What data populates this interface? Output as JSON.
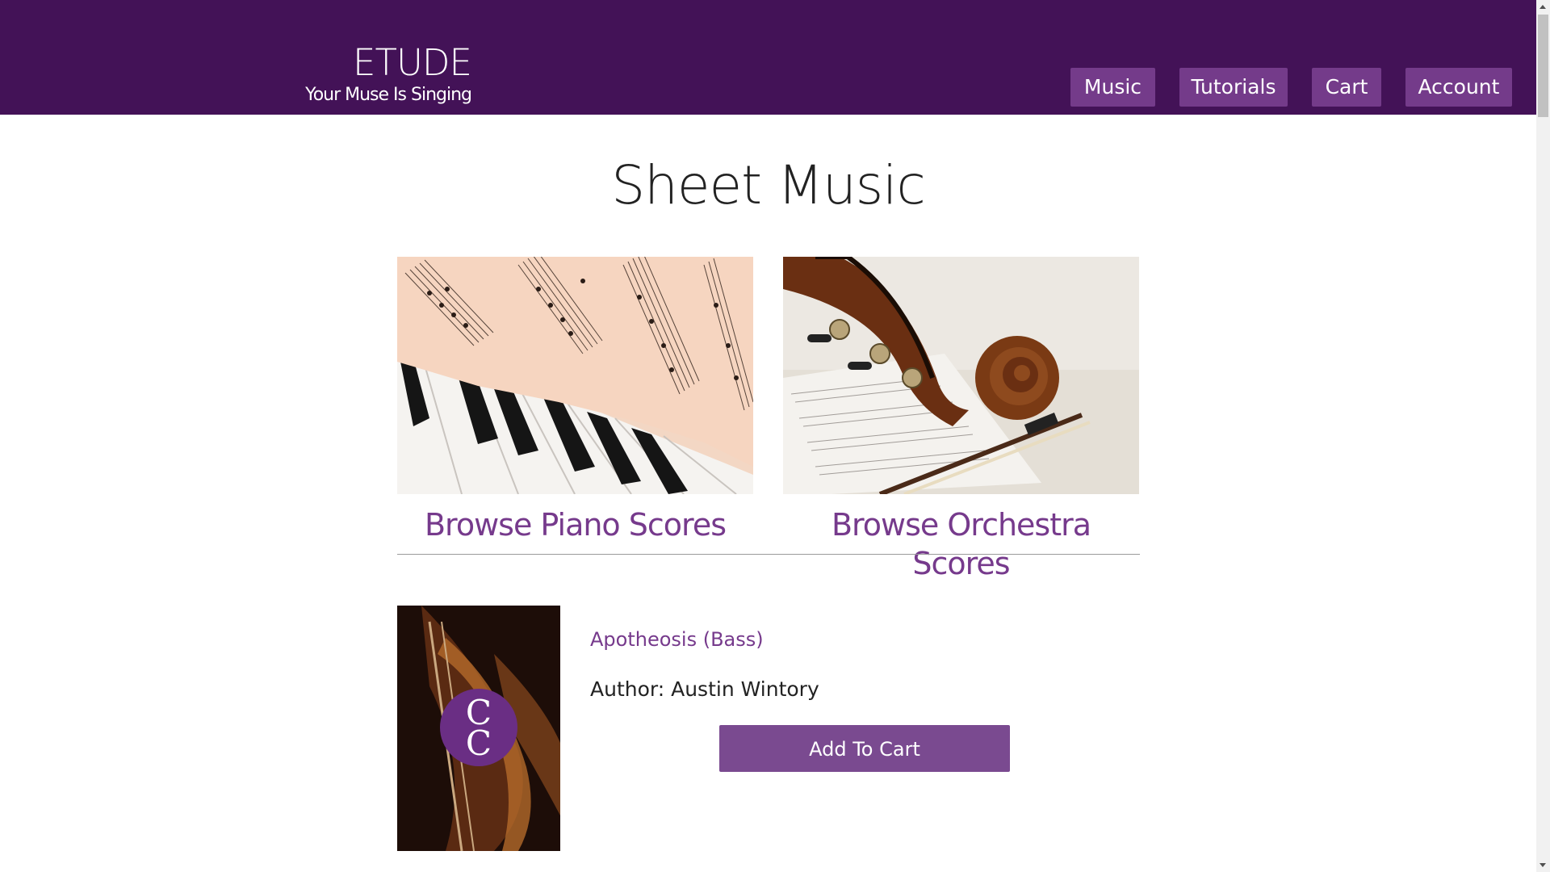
{
  "header": {
    "brand_title": "ETUDE",
    "brand_tagline": "Your Muse Is Singing",
    "nav": [
      "Music",
      "Tutorials",
      "Cart",
      "Account"
    ]
  },
  "main": {
    "title": "Sheet Music",
    "categories": [
      {
        "label": "Browse Piano Scores",
        "image": "piano-sheet-music-photo"
      },
      {
        "label": "Browse Orchestra Scores",
        "image": "cello-scroll-and-bow-photo"
      }
    ],
    "product": {
      "title": "Apotheosis (Bass)",
      "author": "Author: Austin Wintory",
      "button": "Add To Cart",
      "image": "violin-cover-with-logo"
    }
  },
  "colors": {
    "header_bg": "#431257",
    "nav_button_bg": "#743b8a",
    "link": "#763a8c",
    "add_button_bg": "#7a4a90"
  }
}
